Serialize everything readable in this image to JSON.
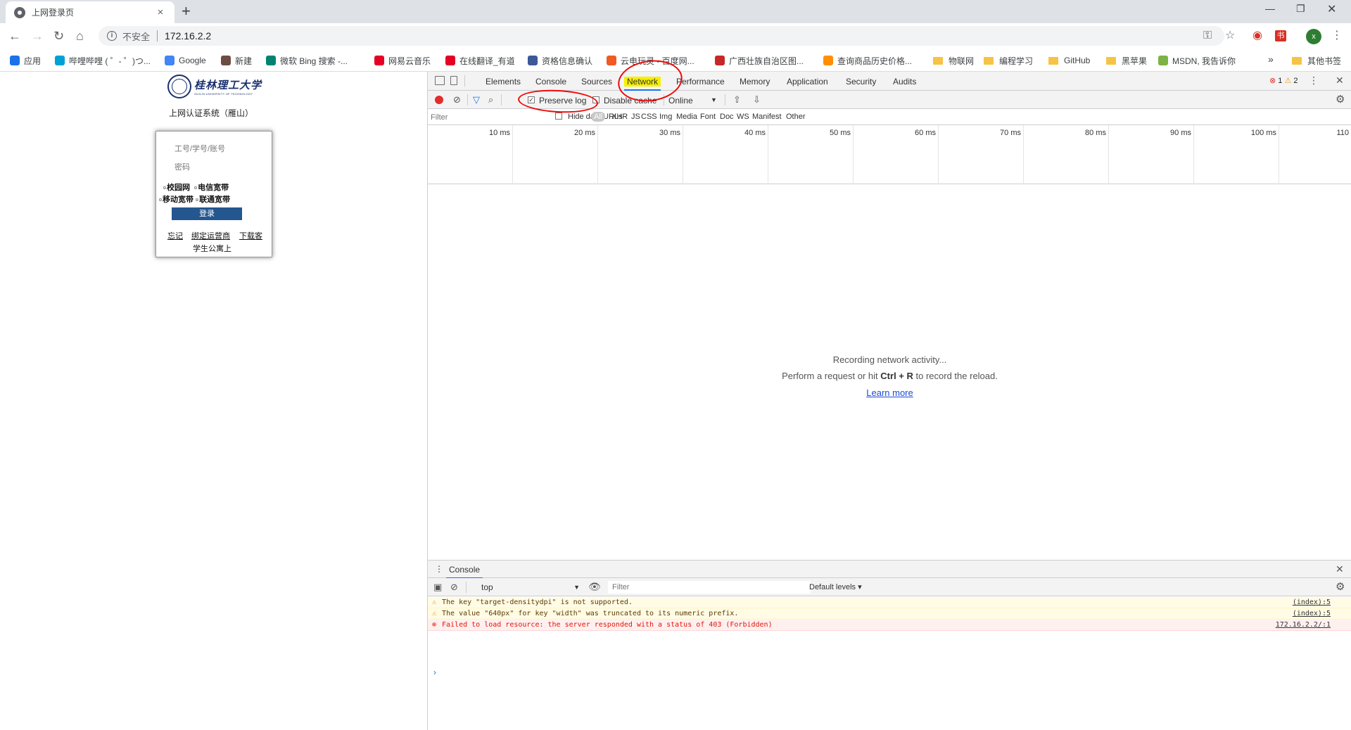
{
  "tab": {
    "title": "上网登录页",
    "close": "×"
  },
  "toolbar": {
    "security_label": "不安全",
    "url": "172.16.2.2"
  },
  "bookmarks": [
    {
      "label": "应用",
      "color": "#1a73e8"
    },
    {
      "label": "哔哩哔哩 ( ゜- ゜)つ...",
      "color": "#00a1d6"
    },
    {
      "label": "Google",
      "color": "#4285f4"
    },
    {
      "label": "新建",
      "color": "#6d4c41"
    },
    {
      "label": "微软 Bing 搜索 -...",
      "color": "#008373"
    },
    {
      "label": "网易云音乐",
      "color": "#e60026"
    },
    {
      "label": "在线翻译_有道",
      "color": "#e60026"
    },
    {
      "label": "资格信息确认",
      "color": "#3b5998"
    },
    {
      "label": "云电玩灵 - 百度网...",
      "color": "#f05a24"
    },
    {
      "label": "广西壮族自治区图...",
      "color": "#c62828"
    },
    {
      "label": "查询商品历史价格...",
      "color": "#ff8f00"
    },
    {
      "label": "物联网",
      "color": "folder"
    },
    {
      "label": "编程学习",
      "color": "folder"
    },
    {
      "label": "GitHub",
      "color": "folder"
    },
    {
      "label": "黑苹果",
      "color": "folder"
    },
    {
      "label": "MSDN, 我告诉你",
      "color": "#7cb342"
    }
  ],
  "bookmarks_overflow": "»",
  "other_bookmarks": "其他书签",
  "login_page": {
    "logo_cn": "桂林理工大学",
    "logo_en": "GUILIN UNIVERSITY OF TECHNOLOGY",
    "auth_title": "上网认证系统（雁山）",
    "account_placeholder": "工号/学号/账号",
    "password_placeholder": "密码",
    "isp_row1": [
      "校园网",
      "电信宽带"
    ],
    "isp_row2": [
      "移动宽带",
      "联通宽带"
    ],
    "login_button": "登录",
    "links": [
      "忘记",
      "绑定运营商",
      "下载客"
    ],
    "note": "学生公寓上"
  },
  "devtools": {
    "tabs": [
      "Elements",
      "Console",
      "Sources",
      "Network",
      "Performance",
      "Memory",
      "Application",
      "Security",
      "Audits"
    ],
    "active_tab": "Network",
    "error_count": "1",
    "warning_count": "2",
    "preserve_log": "Preserve log",
    "disable_cache": "Disable cache",
    "throttle": "Online",
    "filter_placeholder": "Filter",
    "hide_data_urls": "Hide data URLs",
    "types": [
      "All",
      "XHR",
      "JS",
      "CSS",
      "Img",
      "Media",
      "Font",
      "Doc",
      "WS",
      "Manifest",
      "Other"
    ],
    "timeline_ticks": [
      "10 ms",
      "20 ms",
      "30 ms",
      "40 ms",
      "50 ms",
      "60 ms",
      "70 ms",
      "80 ms",
      "90 ms",
      "100 ms",
      "110"
    ],
    "empty_title": "Recording network activity...",
    "empty_hint_pre": "Perform a request or hit",
    "empty_hint_keys": "Ctrl + R",
    "empty_hint_post": "to record the reload.",
    "learn_more": "Learn more"
  },
  "console": {
    "tab": "Console",
    "context": "top",
    "filter_placeholder": "Filter",
    "levels": "Default levels ▾",
    "messages": [
      {
        "level": "warn",
        "text": "The key \"target-densitydpi\" is not supported.",
        "source": "(index):5"
      },
      {
        "level": "warn",
        "text": "The value \"640px\" for key \"width\" was truncated to its numeric prefix.",
        "source": "(index):5"
      },
      {
        "level": "error",
        "text": "Failed to load resource: the server responded with a status of 403 (Forbidden)",
        "source": "172.16.2.2/:1"
      }
    ],
    "prompt": "›"
  }
}
